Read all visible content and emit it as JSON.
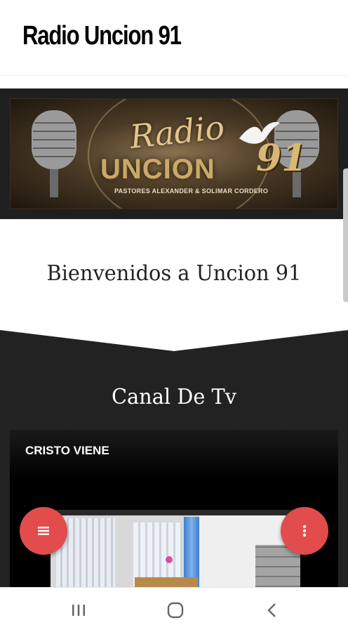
{
  "header": {
    "title": "Radio Uncion 91"
  },
  "banner": {
    "script_text": "Radio",
    "brand_text": "UNCION",
    "number_text": "91",
    "subtitle": "PASTORES ALEXANDER & SOLIMAR CORDERO"
  },
  "main": {
    "welcome": "Bienvenidos a Uncion 91",
    "section_title": "Canal De Tv",
    "video": {
      "title": "CRISTO VIENE"
    }
  },
  "colors": {
    "fab": "#e34c4c",
    "dark_section": "#222222",
    "header_bg": "#ffffff"
  },
  "icons": {
    "fab_left": "menu-icon",
    "fab_right": "more-vertical-icon",
    "nav": [
      "recent-apps-icon",
      "home-icon",
      "back-icon"
    ]
  }
}
